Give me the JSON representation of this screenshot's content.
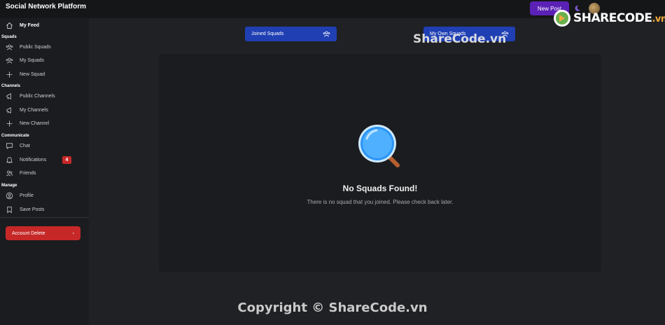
{
  "header": {
    "app_title": "Social Network Platform",
    "new_post_label": "New Post",
    "moon_icon": "moon-icon"
  },
  "brand_logo": {
    "text": "SHARECODE",
    "suffix": ".vn"
  },
  "sidebar": {
    "my_feed": "My Feed",
    "sections": {
      "squads": "Squads",
      "channels": "Channels",
      "communicate": "Communicate",
      "manage": "Manage"
    },
    "items": {
      "public_squads": "Public Squads",
      "my_squads": "My Squads",
      "new_squad": "New Squad",
      "public_channels": "Public Channels",
      "my_channels": "My Channels",
      "new_channel": "New Channel",
      "chat": "Chat",
      "notifications": "Notifications",
      "friends": "Friends",
      "profile": "Profile",
      "save_posts": "Save Posts"
    },
    "notifications_count": "4",
    "account_delete": "Account Delete",
    "account_delete_dash": "-"
  },
  "tabs": {
    "joined": "Joined Squads",
    "own": "My Own Squads"
  },
  "empty_state": {
    "title": "No Squads Found!",
    "description": "There is no squad that you joined. Please check back later."
  },
  "watermarks": {
    "top": "ShareCode.vn",
    "bottom": "Copyright © ShareCode.vn"
  },
  "colors": {
    "accent_blue": "#1f3fb3",
    "danger_red": "#c62828",
    "new_post_purple": "#5b21b6"
  }
}
